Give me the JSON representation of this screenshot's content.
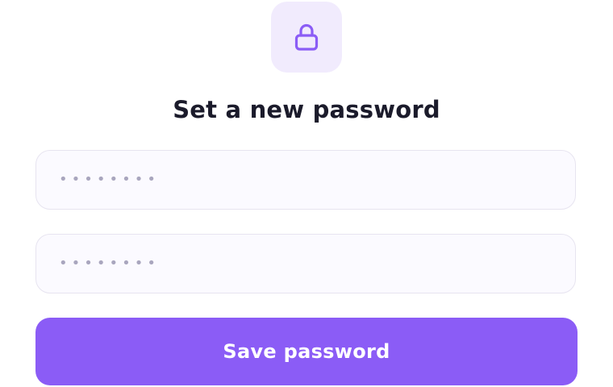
{
  "header": {
    "icon": "lock-icon",
    "title": "Set a new password"
  },
  "form": {
    "new_password": {
      "masked_value": "••••••••"
    },
    "confirm_password": {
      "masked_value": "••••••••"
    },
    "save_label": "Save password"
  },
  "colors": {
    "accent": "#8b5cf6",
    "icon_tile_bg": "#f1ebfd",
    "title_text": "#1b1b2b",
    "field_border": "#e7e4f0",
    "field_bg": "#fbfaff",
    "placeholder_dots": "#a9a6be"
  }
}
